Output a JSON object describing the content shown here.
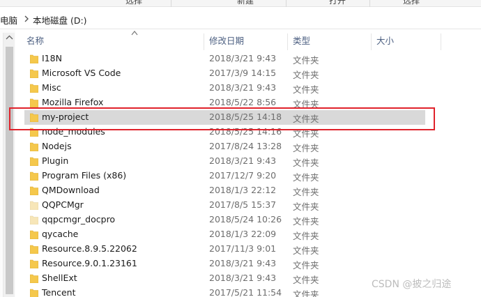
{
  "ribbon": {
    "items": [
      "选择",
      "新建",
      "打开",
      "选择"
    ]
  },
  "breadcrumb": {
    "item1": "电脑",
    "item2": "本地磁盘 (D:)"
  },
  "columns": {
    "name": "名称",
    "date": "修改日期",
    "type": "类型",
    "size": "大小"
  },
  "rows": [
    {
      "name": "I18N",
      "date": "2018/3/21 9:43",
      "type": "文件夹"
    },
    {
      "name": "Microsoft VS Code",
      "date": "2017/3/9 14:15",
      "type": "文件夹"
    },
    {
      "name": "Misc",
      "date": "2018/3/21 9:43",
      "type": "文件夹"
    },
    {
      "name": "Mozilla Firefox",
      "date": "2018/5/22 8:56",
      "type": "文件夹"
    },
    {
      "name": "my-project",
      "date": "2018/5/25 14:18",
      "type": "文件夹",
      "selected": true
    },
    {
      "name": "node_modules",
      "date": "2018/5/25 14:16",
      "type": "文件夹"
    },
    {
      "name": "Nodejs",
      "date": "2017/8/24 13:28",
      "type": "文件夹"
    },
    {
      "name": "Plugin",
      "date": "2018/3/21 9:43",
      "type": "文件夹"
    },
    {
      "name": "Program Files (x86)",
      "date": "2017/12/7 9:20",
      "type": "文件夹"
    },
    {
      "name": "QMDownload",
      "date": "2018/1/3 22:12",
      "type": "文件夹"
    },
    {
      "name": "QQPCMgr",
      "date": "2017/8/5 15:37",
      "type": "文件夹",
      "light": true
    },
    {
      "name": "qqpcmgr_docpro",
      "date": "2018/5/24 10:26",
      "type": "文件夹",
      "light": true
    },
    {
      "name": "qycache",
      "date": "2018/1/3 22:09",
      "type": "文件夹"
    },
    {
      "name": "Resource.8.9.5.22062",
      "date": "2017/11/3 9:01",
      "type": "文件夹"
    },
    {
      "name": "Resource.9.0.1.23161",
      "date": "2018/3/21 9:43",
      "type": "文件夹"
    },
    {
      "name": "ShellExt",
      "date": "2018/3/21 9:43",
      "type": "文件夹"
    },
    {
      "name": "Tencent",
      "date": "2017/5/21 11:54",
      "type": "文件夹"
    }
  ],
  "colors": {
    "folder": "#f5c84c",
    "folder_light": "#f7e6b8",
    "highlight": "#e0222b",
    "selected_bg": "#d9d9d9"
  },
  "watermark": "CSDN @披之归途"
}
